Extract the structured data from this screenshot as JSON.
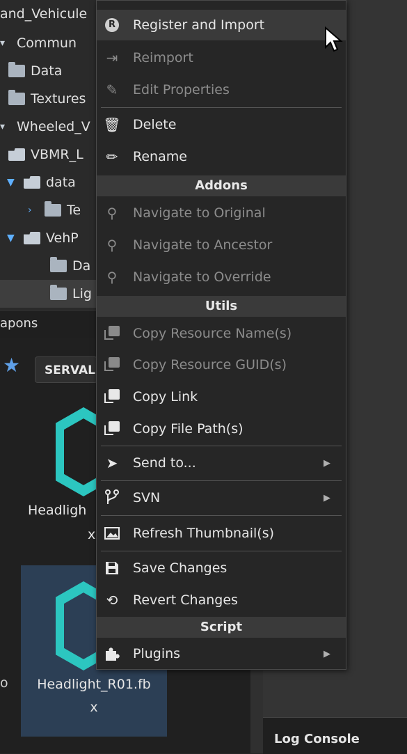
{
  "tree": {
    "rows": [
      {
        "label": "and_Vehicule"
      },
      {
        "label": "Commun"
      },
      {
        "label": "Data"
      },
      {
        "label": "Textures"
      },
      {
        "label": "Wheeled_V"
      },
      {
        "label": "VBMR_L"
      },
      {
        "label": "data"
      },
      {
        "label": "Te"
      },
      {
        "label": "VehP"
      },
      {
        "label": "Da"
      },
      {
        "label": "Lig"
      }
    ],
    "tab_label": "apons"
  },
  "browser": {
    "toolbar_button": "SERVAL",
    "assets": [
      {
        "name_line1": "Headligh",
        "name_line2": "x"
      },
      {
        "name_line1": "Headlight_R01.fb",
        "name_line2": "x"
      }
    ],
    "left_fragment": "o"
  },
  "log_console": {
    "title": "Log Console"
  },
  "menu": {
    "items": {
      "register_import": "Register and Import",
      "reimport": "Reimport",
      "edit_properties": "Edit Properties",
      "delete": "Delete",
      "rename": "Rename",
      "navigate_original": "Navigate to Original",
      "navigate_ancestor": "Navigate to Ancestor",
      "navigate_override": "Navigate to Override",
      "copy_resource_name": "Copy Resource Name(s)",
      "copy_resource_guid": "Copy Resource GUID(s)",
      "copy_link": "Copy Link",
      "copy_file_path": "Copy File Path(s)",
      "send_to": "Send to...",
      "svn": "SVN",
      "refresh_thumbnail": "Refresh Thumbnail(s)",
      "save_changes": "Save Changes",
      "revert_changes": "Revert Changes",
      "plugins": "Plugins"
    },
    "headers": {
      "addons": "Addons",
      "utils": "Utils",
      "script": "Script"
    }
  },
  "colors": {
    "accent_cyan": "#2cc6c0",
    "selection_blue": "#2c3f55",
    "menu_bg": "#262626"
  }
}
